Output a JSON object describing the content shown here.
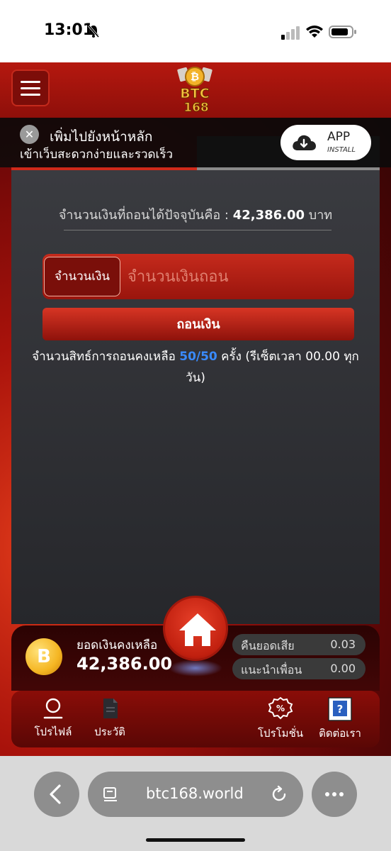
{
  "status_bar": {
    "time": "13:01",
    "icons": [
      "bell-off-icon",
      "signal-icon",
      "wifi-icon",
      "battery-icon"
    ]
  },
  "header": {
    "menu_icon": "hamburger-icon",
    "logo_text": "BTC 168"
  },
  "add_to_home": {
    "title": "เพิ่มไปยังหน้าหลัก",
    "subtitle": "เข้าเว็บสะดวกง่ายและรวดเร็ว",
    "close_icon": "close-icon",
    "app_button_label": "APP",
    "app_button_sub": "INSTALL"
  },
  "withdraw": {
    "available_label": "จำนวนเงินที่ถอนได้ปัจจุบันคือ : ",
    "available_amount": "42,386.00",
    "currency": " บาท",
    "amount_label": "จำนวนเงิน",
    "amount_placeholder": "จำนวนเงินถอน",
    "amount_value": "",
    "submit_label": "ถอนเงิน",
    "rights_prefix": "จำนวนสิทธ์การถอนคงเหลือ ",
    "rights_count": "50/50",
    "rights_suffix": " ครั้ง (รีเซ็ตเวลา 00.00 ทุกวัน)"
  },
  "balance_card": {
    "coin_symbol": "B",
    "label": "ยอดเงินคงเหลือ",
    "value": "42,386.00",
    "cashback_label": "คืนยอดเสีย",
    "cashback_value": "0.03",
    "referral_label": "แนะนำเพื่อน",
    "referral_value": "0.00"
  },
  "bottom_nav": {
    "items": [
      {
        "label": "โปรไฟล์",
        "icon": "profile-icon"
      },
      {
        "label": "ประวัติ",
        "icon": "history-icon"
      },
      {
        "label": "โปรโมชั่น",
        "icon": "promotion-icon"
      },
      {
        "label": "ติดต่อเรา",
        "icon": "contact-icon"
      }
    ],
    "home_icon": "home-icon"
  },
  "browser": {
    "url": "btc168.world"
  },
  "colors": {
    "primary_red": "#c1200f",
    "highlight_blue": "#3a8bff",
    "panel_dark": "#2f3034"
  }
}
